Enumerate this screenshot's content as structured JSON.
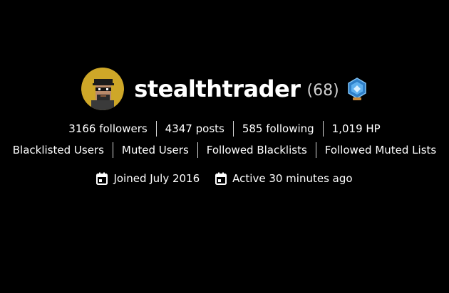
{
  "profile": {
    "username": "stealthtrader",
    "reputation": "(68)",
    "avatar_icon": "pixel-character-avatar",
    "badge_icon": "blue-rank-badge-icon"
  },
  "stats": [
    {
      "label": "3166 followers"
    },
    {
      "label": "4347 posts"
    },
    {
      "label": "585 following"
    },
    {
      "label": "1,019 HP"
    }
  ],
  "lists": [
    {
      "label": "Blacklisted Users"
    },
    {
      "label": "Muted Users"
    },
    {
      "label": "Followed Blacklists"
    },
    {
      "label": "Followed Muted Lists"
    }
  ],
  "dates": {
    "joined": "Joined July 2016",
    "active": "Active 30 minutes ago"
  },
  "colors": {
    "background": "#000000",
    "text": "#ffffff",
    "reputation": "#cfcfcf",
    "avatar_bg": "#c9a227",
    "badge": "#3b8fd6"
  }
}
